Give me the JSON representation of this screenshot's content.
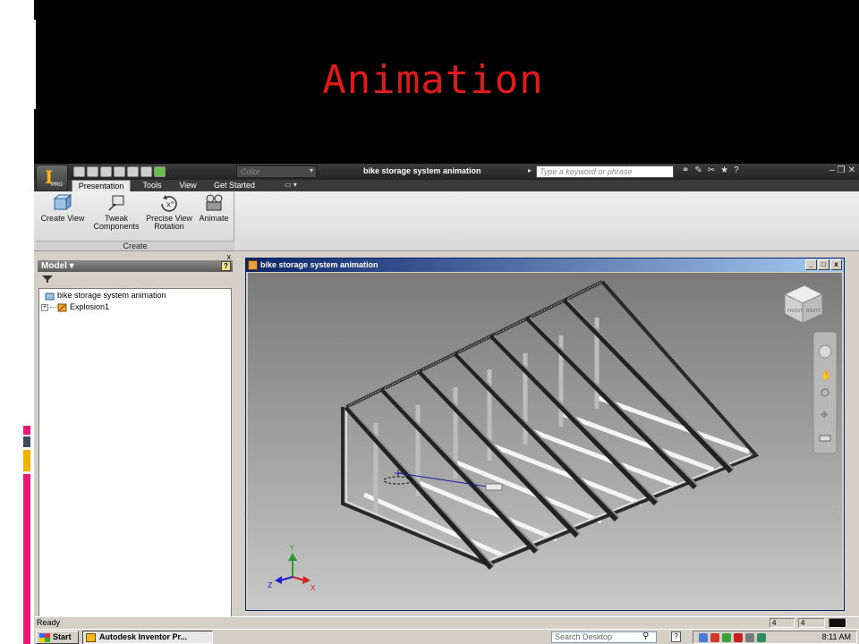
{
  "slide": {
    "title": "Animation",
    "title_color": "#e01a1a",
    "accent_colors": [
      "#e8177a",
      "#3b4a5c",
      "#f0b400",
      "#e8177a"
    ]
  },
  "app": {
    "logo_letter": "I",
    "logo_sub": "PRO",
    "color_combo": "Color",
    "document_title": "bike storage system animation",
    "search_placeholder": "Type a keyword or phrase",
    "tabs": [
      {
        "label": "Presentation",
        "active": true
      },
      {
        "label": "Tools",
        "active": false
      },
      {
        "label": "View",
        "active": false
      },
      {
        "label": "Get Started",
        "active": false
      }
    ],
    "ribbon": {
      "buttons": [
        {
          "label": "Create View",
          "icon": "create-view-icon"
        },
        {
          "label": "Tweak Components",
          "icon": "tweak-components-icon"
        },
        {
          "label": "Precise View Rotation",
          "icon": "precise-view-rotation-icon"
        },
        {
          "label": "Animate",
          "icon": "animate-icon"
        }
      ],
      "panel_label": "Create"
    },
    "browser": {
      "title": "Model",
      "help": "?",
      "close": "x",
      "tree": [
        {
          "label": "bike storage system animation",
          "icon": "presentation-icon"
        },
        {
          "label": "Explosion1",
          "icon": "explosion-icon",
          "expander": "+"
        }
      ]
    },
    "document_window": {
      "caption": "bike storage system animation",
      "buttons": [
        "_",
        "□",
        "x"
      ]
    },
    "viewcube": {
      "faces": [
        "FRONT",
        "RIGHT"
      ]
    },
    "triad": {
      "x": "X",
      "y": "Y",
      "z": "Z"
    },
    "status": {
      "text": "Ready",
      "field_a": "4",
      "field_b": "4"
    }
  },
  "taskbar": {
    "start": "Start",
    "task_item": "Autodesk Inventor Pr...",
    "search_placeholder": "Search Desktop",
    "clock": "8:11 AM"
  }
}
